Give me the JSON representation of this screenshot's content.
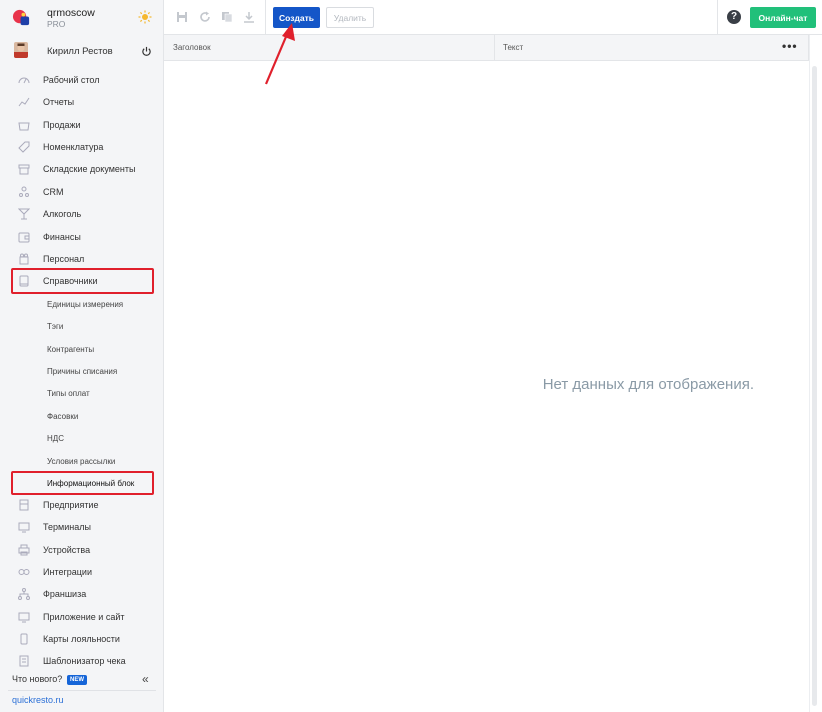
{
  "brand": {
    "name": "qrmoscow",
    "plan": "PRO"
  },
  "user": {
    "name": "Кирилл Рестов"
  },
  "nav": [
    {
      "label": "Рабочий стол",
      "icon": "dashboard-icon"
    },
    {
      "label": "Отчеты",
      "icon": "chart-icon"
    },
    {
      "label": "Продажи",
      "icon": "basket-icon"
    },
    {
      "label": "Номенклатура",
      "icon": "tag-icon"
    },
    {
      "label": "Складские документы",
      "icon": "archive-icon"
    },
    {
      "label": "CRM",
      "icon": "people-icon"
    },
    {
      "label": "Алкоголь",
      "icon": "glass-icon"
    },
    {
      "label": "Финансы",
      "icon": "wallet-icon"
    },
    {
      "label": "Персонал",
      "icon": "staff-icon"
    },
    {
      "label": "Справочники",
      "icon": "book-icon"
    }
  ],
  "sub_nav": [
    {
      "label": "Единицы измерения"
    },
    {
      "label": "Тэги"
    },
    {
      "label": "Контрагенты"
    },
    {
      "label": "Причины списания"
    },
    {
      "label": "Типы оплат"
    },
    {
      "label": "Фасовки"
    },
    {
      "label": "НДС"
    },
    {
      "label": "Условия рассылки"
    },
    {
      "label": "Информационный блок"
    }
  ],
  "nav_bottom": [
    {
      "label": "Предприятие",
      "icon": "building-icon"
    },
    {
      "label": "Терминалы",
      "icon": "terminal-icon"
    },
    {
      "label": "Устройства",
      "icon": "printer-icon"
    },
    {
      "label": "Интеграции",
      "icon": "link-icon"
    },
    {
      "label": "Франшиза",
      "icon": "network-icon"
    },
    {
      "label": "Приложение и сайт",
      "icon": "monitor-icon"
    },
    {
      "label": "Карты лояльности",
      "icon": "card-icon"
    },
    {
      "label": "Шаблонизатор чека",
      "icon": "receipt-icon"
    }
  ],
  "footer": {
    "whats_new": "Что нового?",
    "new_badge": "NEW",
    "site": "quickresto.ru"
  },
  "toolbar": {
    "create_label": "Создать",
    "delete_label": "Удалить",
    "chat_label": "Онлайн-чат",
    "help": "?"
  },
  "grid": {
    "columns": [
      "Заголовок",
      "Текст"
    ],
    "menu": "•••",
    "empty_message": "Нет данных для отображения."
  },
  "colors": {
    "accent": "#1456c8",
    "chat": "#21c07a",
    "highlight": "#e0202c"
  }
}
